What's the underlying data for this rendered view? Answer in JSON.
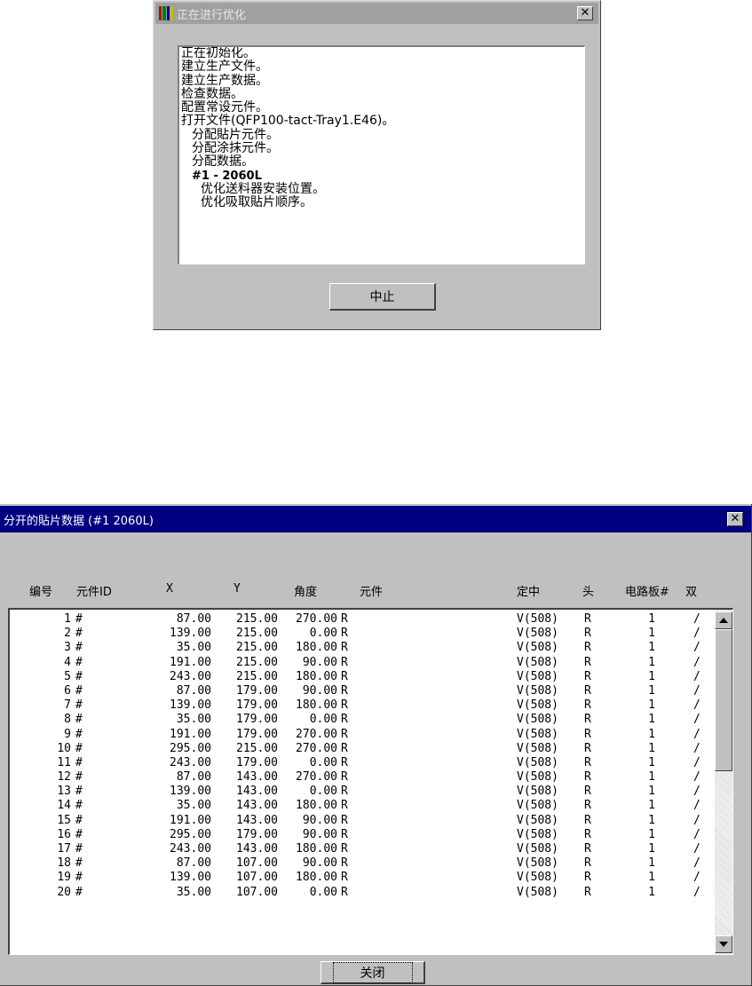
{
  "optimize_dialog": {
    "title": "正在进行优化",
    "log_lines": [
      {
        "text": "正在初始化。",
        "indent": 0,
        "bold": false
      },
      {
        "text": "建立生产文件。",
        "indent": 0,
        "bold": false
      },
      {
        "text": "建立生产数据。",
        "indent": 0,
        "bold": false
      },
      {
        "text": "检查数据。",
        "indent": 0,
        "bold": false
      },
      {
        "text": "配置常设元件。",
        "indent": 0,
        "bold": false
      },
      {
        "text": "打开文件(QFP100-tact-Tray1.E46)。",
        "indent": 0,
        "bold": false
      },
      {
        "text": "分配貼片元件。",
        "indent": 1,
        "bold": false
      },
      {
        "text": "分配涂抹元件。",
        "indent": 1,
        "bold": false
      },
      {
        "text": "分配数据。",
        "indent": 1,
        "bold": false
      },
      {
        "text": "#1 - 2060L",
        "indent": 1,
        "bold": true
      },
      {
        "text": "优化送料器安装位置。",
        "indent": 2,
        "bold": false
      },
      {
        "text": "优化吸取貼片顺序。",
        "indent": 2,
        "bold": false
      }
    ],
    "abort_label": "中止"
  },
  "data_dialog": {
    "title": "分开的貼片数据 (#1   2060L)",
    "columns": {
      "no": "编号",
      "part_id": "元件ID",
      "x": "X",
      "y": "Y",
      "angle": "角度",
      "part": "元件",
      "centering": "定中",
      "head": "头",
      "board": "电路板#",
      "double": "双"
    },
    "rows": [
      {
        "no": "1",
        "id": "#",
        "x": "87.00",
        "y": "215.00",
        "angle": "270.00",
        "rot": "R",
        "center": "V(508)",
        "head": "R",
        "board": "1",
        "dbl": "/"
      },
      {
        "no": "2",
        "id": "#",
        "x": "139.00",
        "y": "215.00",
        "angle": "0.00",
        "rot": "R",
        "center": "V(508)",
        "head": "R",
        "board": "1",
        "dbl": "/"
      },
      {
        "no": "3",
        "id": "#",
        "x": "35.00",
        "y": "215.00",
        "angle": "180.00",
        "rot": "R",
        "center": "V(508)",
        "head": "R",
        "board": "1",
        "dbl": "/"
      },
      {
        "no": "4",
        "id": "#",
        "x": "191.00",
        "y": "215.00",
        "angle": "90.00",
        "rot": "R",
        "center": "V(508)",
        "head": "R",
        "board": "1",
        "dbl": "/"
      },
      {
        "no": "5",
        "id": "#",
        "x": "243.00",
        "y": "215.00",
        "angle": "180.00",
        "rot": "R",
        "center": "V(508)",
        "head": "R",
        "board": "1",
        "dbl": "/"
      },
      {
        "no": "6",
        "id": "#",
        "x": "87.00",
        "y": "179.00",
        "angle": "90.00",
        "rot": "R",
        "center": "V(508)",
        "head": "R",
        "board": "1",
        "dbl": "/"
      },
      {
        "no": "7",
        "id": "#",
        "x": "139.00",
        "y": "179.00",
        "angle": "180.00",
        "rot": "R",
        "center": "V(508)",
        "head": "R",
        "board": "1",
        "dbl": "/"
      },
      {
        "no": "8",
        "id": "#",
        "x": "35.00",
        "y": "179.00",
        "angle": "0.00",
        "rot": "R",
        "center": "V(508)",
        "head": "R",
        "board": "1",
        "dbl": "/"
      },
      {
        "no": "9",
        "id": "#",
        "x": "191.00",
        "y": "179.00",
        "angle": "270.00",
        "rot": "R",
        "center": "V(508)",
        "head": "R",
        "board": "1",
        "dbl": "/"
      },
      {
        "no": "10",
        "id": "#",
        "x": "295.00",
        "y": "215.00",
        "angle": "270.00",
        "rot": "R",
        "center": "V(508)",
        "head": "R",
        "board": "1",
        "dbl": "/"
      },
      {
        "no": "11",
        "id": "#",
        "x": "243.00",
        "y": "179.00",
        "angle": "0.00",
        "rot": "R",
        "center": "V(508)",
        "head": "R",
        "board": "1",
        "dbl": "/"
      },
      {
        "no": "12",
        "id": "#",
        "x": "87.00",
        "y": "143.00",
        "angle": "270.00",
        "rot": "R",
        "center": "V(508)",
        "head": "R",
        "board": "1",
        "dbl": "/"
      },
      {
        "no": "13",
        "id": "#",
        "x": "139.00",
        "y": "143.00",
        "angle": "0.00",
        "rot": "R",
        "center": "V(508)",
        "head": "R",
        "board": "1",
        "dbl": "/"
      },
      {
        "no": "14",
        "id": "#",
        "x": "35.00",
        "y": "143.00",
        "angle": "180.00",
        "rot": "R",
        "center": "V(508)",
        "head": "R",
        "board": "1",
        "dbl": "/"
      },
      {
        "no": "15",
        "id": "#",
        "x": "191.00",
        "y": "143.00",
        "angle": "90.00",
        "rot": "R",
        "center": "V(508)",
        "head": "R",
        "board": "1",
        "dbl": "/"
      },
      {
        "no": "16",
        "id": "#",
        "x": "295.00",
        "y": "179.00",
        "angle": "90.00",
        "rot": "R",
        "center": "V(508)",
        "head": "R",
        "board": "1",
        "dbl": "/"
      },
      {
        "no": "17",
        "id": "#",
        "x": "243.00",
        "y": "143.00",
        "angle": "180.00",
        "rot": "R",
        "center": "V(508)",
        "head": "R",
        "board": "1",
        "dbl": "/"
      },
      {
        "no": "18",
        "id": "#",
        "x": "87.00",
        "y": "107.00",
        "angle": "90.00",
        "rot": "R",
        "center": "V(508)",
        "head": "R",
        "board": "1",
        "dbl": "/"
      },
      {
        "no": "19",
        "id": "#",
        "x": "139.00",
        "y": "107.00",
        "angle": "180.00",
        "rot": "R",
        "center": "V(508)",
        "head": "R",
        "board": "1",
        "dbl": "/"
      },
      {
        "no": "20",
        "id": "#",
        "x": "35.00",
        "y": "107.00",
        "angle": "0.00",
        "rot": "R",
        "center": "V(508)",
        "head": "R",
        "board": "1",
        "dbl": "/"
      }
    ],
    "close_label": "关闭"
  },
  "icons": {
    "app_icon": "film-strip-icon",
    "close": "close-x-icon",
    "scroll_up": "arrow-up-icon",
    "scroll_down": "arrow-down-icon"
  },
  "colors": {
    "inactive_title": "#a0a0a0",
    "active_title": "#000080",
    "face": "#c0c0c0"
  }
}
